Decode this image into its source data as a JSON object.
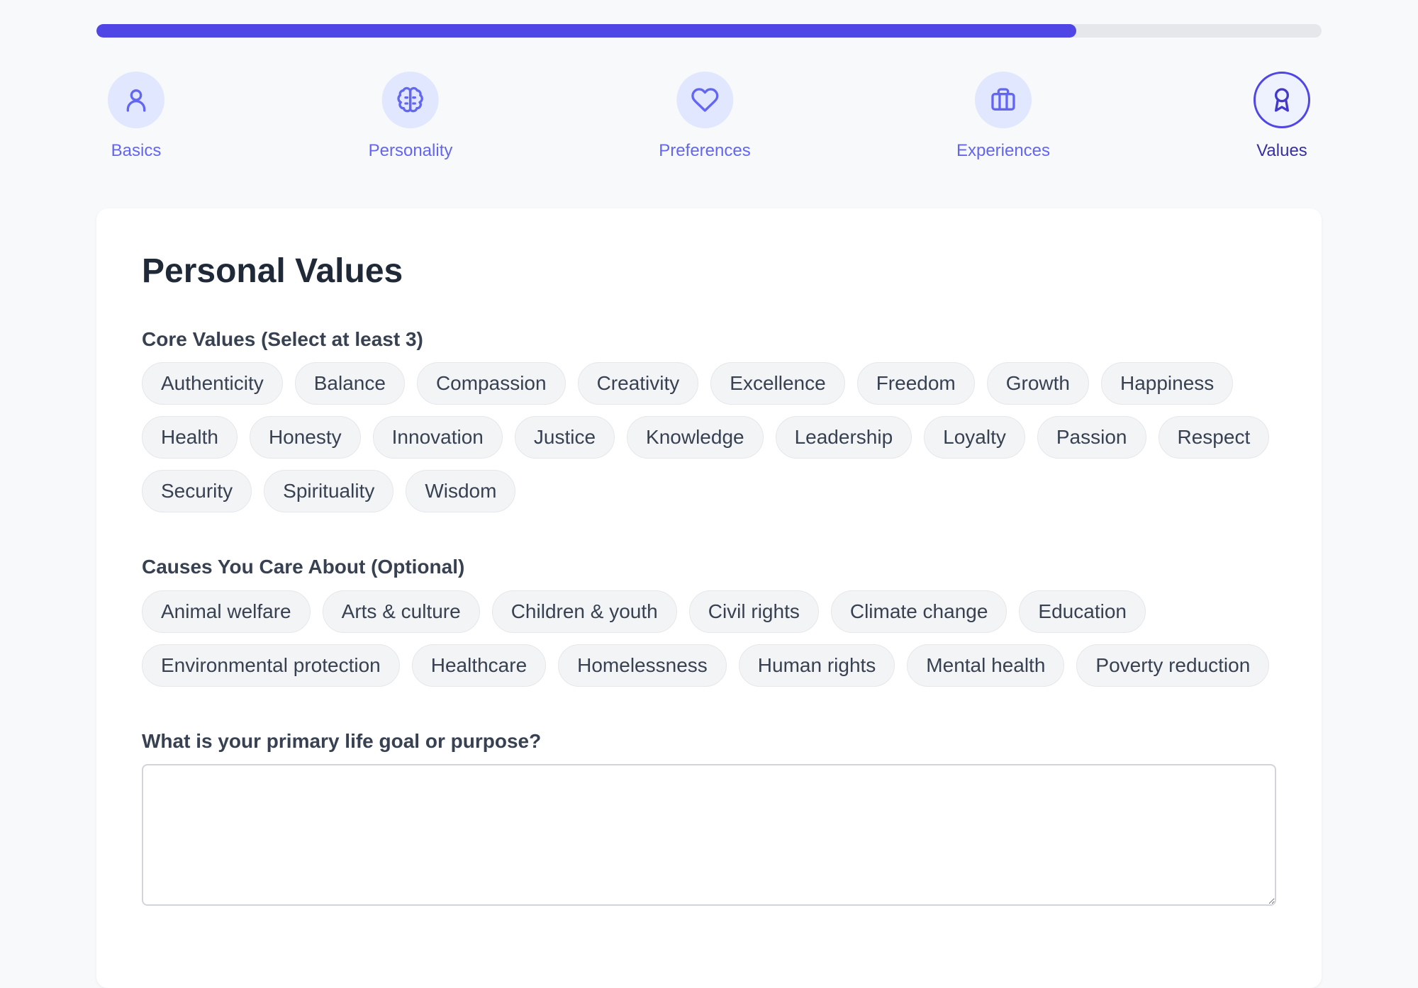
{
  "progress": {
    "percent": 80,
    "color": "#4f46e5"
  },
  "steps": [
    {
      "label": "Basics",
      "icon": "user-icon",
      "state": "completed"
    },
    {
      "label": "Personality",
      "icon": "brain-icon",
      "state": "completed"
    },
    {
      "label": "Preferences",
      "icon": "heart-icon",
      "state": "completed"
    },
    {
      "label": "Experiences",
      "icon": "briefcase-icon",
      "state": "completed"
    },
    {
      "label": "Values",
      "icon": "award-icon",
      "state": "active"
    }
  ],
  "form": {
    "title": "Personal Values",
    "core_values": {
      "label": "Core Values (Select at least 3)",
      "options": [
        "Authenticity",
        "Balance",
        "Compassion",
        "Creativity",
        "Excellence",
        "Freedom",
        "Growth",
        "Happiness",
        "Health",
        "Honesty",
        "Innovation",
        "Justice",
        "Knowledge",
        "Leadership",
        "Loyalty",
        "Passion",
        "Respect",
        "Security",
        "Spirituality",
        "Wisdom"
      ]
    },
    "causes": {
      "label": "Causes You Care About (Optional)",
      "options": [
        "Animal welfare",
        "Arts & culture",
        "Children & youth",
        "Civil rights",
        "Climate change",
        "Education",
        "Environmental protection",
        "Healthcare",
        "Homelessness",
        "Human rights",
        "Mental health",
        "Poverty reduction"
      ]
    },
    "life_goal": {
      "label": "What is your primary life goal or purpose?",
      "value": "",
      "placeholder": ""
    }
  }
}
